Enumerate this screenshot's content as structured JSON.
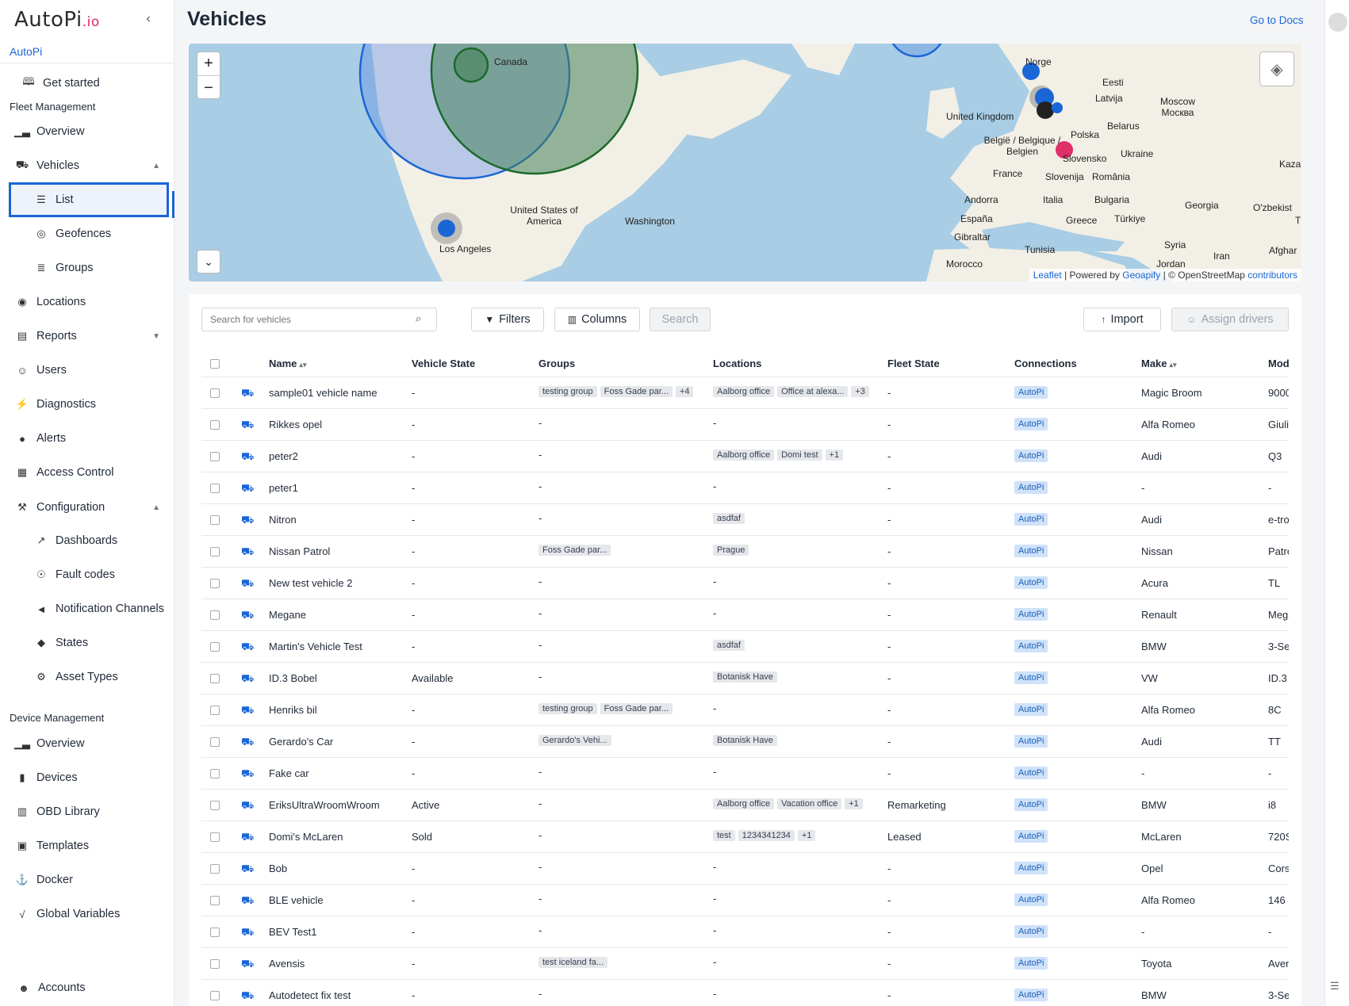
{
  "sidebar": {
    "logo_main": "AutoPi",
    "logo_suffix": ".io",
    "org": "AutoPi",
    "get_started": "Get started",
    "fleet_management": "Fleet Management",
    "overview": "Overview",
    "vehicles": "Vehicles",
    "list": "List",
    "geofences": "Geofences",
    "groups": "Groups",
    "locations": "Locations",
    "reports": "Reports",
    "users": "Users",
    "diagnostics": "Diagnostics",
    "alerts": "Alerts",
    "access_control": "Access Control",
    "configuration": "Configuration",
    "dashboards": "Dashboards",
    "fault_codes": "Fault codes",
    "notification_channels": "Notification Channels",
    "states": "States",
    "asset_types": "Asset Types",
    "device_management": "Device Management",
    "dm_overview": "Overview",
    "devices": "Devices",
    "obd_library": "OBD Library",
    "templates": "Templates",
    "docker": "Docker",
    "global_variables": "Global Variables",
    "accounts": "Accounts"
  },
  "header": {
    "title": "Vehicles",
    "docs_link": "Go to Docs"
  },
  "map": {
    "labels": [
      "Canada",
      "United States of America",
      "Washington",
      "Los Angeles",
      "Norge",
      "Eesti",
      "Latvija",
      "United Kingdom",
      "Moscow Москва",
      "Belarus",
      "België / Belgique / Belgien",
      "Polska",
      "Slovensko",
      "Ukraine",
      "France",
      "Slovenija",
      "România",
      "Kazak",
      "Andorra",
      "Italia",
      "Bulgaria",
      "Georgia",
      "O'zbekist",
      "España",
      "Greece",
      "Türkiye",
      "Gibraltar",
      "Tunisia",
      "Syria",
      "Afghar",
      "Morocco",
      "Iran",
      "Jordan",
      "T"
    ],
    "attribution_leaflet": "Leaflet",
    "attribution_powered": "| Powered by",
    "attribution_geoapify": "Geoapify",
    "attribution_osm": "| © OpenStreetMap",
    "attribution_contrib": "contributors"
  },
  "toolbar": {
    "search_placeholder": "Search for vehicles",
    "filters": "Filters",
    "columns": "Columns",
    "search": "Search",
    "import": "Import",
    "assign_drivers": "Assign drivers"
  },
  "table": {
    "headers": {
      "name": "Name",
      "vehicle_state": "Vehicle State",
      "groups": "Groups",
      "locations": "Locations",
      "fleet_state": "Fleet State",
      "connections": "Connections",
      "make": "Make",
      "model": "Mod"
    },
    "rows": [
      {
        "name": "sample01 vehicle name",
        "state": "-",
        "groups": [
          "testing group",
          "Foss Gade par...",
          "+4"
        ],
        "locations": [
          "Aalborg office",
          "Office at alexa...",
          "+3"
        ],
        "fleet": "-",
        "conn": "AutoPi",
        "make": "Magic Broom",
        "model": "9000"
      },
      {
        "name": "Rikkes opel",
        "state": "-",
        "groups": [],
        "locations": [],
        "fleet": "-",
        "conn": "AutoPi",
        "make": "Alfa Romeo",
        "model": "Giuli"
      },
      {
        "name": "peter2",
        "state": "-",
        "groups": [],
        "locations": [
          "Aalborg office",
          "Domi test",
          "+1"
        ],
        "fleet": "-",
        "conn": "AutoPi",
        "make": "Audi",
        "model": "Q3"
      },
      {
        "name": "peter1",
        "state": "-",
        "groups": [],
        "locations": [],
        "fleet": "-",
        "conn": "AutoPi",
        "make": "-",
        "model": "-"
      },
      {
        "name": "Nitron",
        "state": "-",
        "groups": [],
        "locations": [
          "asdfaf"
        ],
        "fleet": "-",
        "conn": "AutoPi",
        "make": "Audi",
        "model": "e-tro"
      },
      {
        "name": "Nissan Patrol",
        "state": "-",
        "groups": [
          "Foss Gade par..."
        ],
        "locations": [
          "Prague"
        ],
        "fleet": "-",
        "conn": "AutoPi",
        "make": "Nissan",
        "model": "Patro"
      },
      {
        "name": "New test vehicle 2",
        "state": "-",
        "groups": [],
        "locations": [],
        "fleet": "-",
        "conn": "AutoPi",
        "make": "Acura",
        "model": "TL"
      },
      {
        "name": "Megane",
        "state": "-",
        "groups": [],
        "locations": [],
        "fleet": "-",
        "conn": "AutoPi",
        "make": "Renault",
        "model": "Mega"
      },
      {
        "name": "Martin's Vehicle Test",
        "state": "-",
        "groups": [],
        "locations": [
          "asdfaf"
        ],
        "fleet": "-",
        "conn": "AutoPi",
        "make": "BMW",
        "model": "3-Se"
      },
      {
        "name": "ID.3 Bobel",
        "state": "Available",
        "groups": [],
        "locations": [
          "Botanisk Have"
        ],
        "fleet": "-",
        "conn": "AutoPi",
        "make": "VW",
        "model": "ID.3"
      },
      {
        "name": "Henriks bil",
        "state": "-",
        "groups": [
          "testing group",
          "Foss Gade par..."
        ],
        "locations": [],
        "fleet": "-",
        "conn": "AutoPi",
        "make": "Alfa Romeo",
        "model": "8C"
      },
      {
        "name": "Gerardo's Car",
        "state": "-",
        "groups": [
          "Gerardo's Vehi..."
        ],
        "locations": [
          "Botanisk Have"
        ],
        "fleet": "-",
        "conn": "AutoPi",
        "make": "Audi",
        "model": "TT"
      },
      {
        "name": "Fake car",
        "state": "-",
        "groups": [],
        "locations": [],
        "fleet": "-",
        "conn": "AutoPi",
        "make": "-",
        "model": "-"
      },
      {
        "name": "EriksUltraWroomWroom",
        "state": "Active",
        "groups": [],
        "locations": [
          "Aalborg office",
          "Vacation office",
          "+1"
        ],
        "fleet": "Remarketing",
        "conn": "AutoPi",
        "make": "BMW",
        "model": "i8"
      },
      {
        "name": "Domi's McLaren",
        "state": "Sold",
        "groups": [],
        "locations": [
          "test",
          "1234341234",
          "+1"
        ],
        "fleet": "Leased",
        "conn": "AutoPi",
        "make": "McLaren",
        "model": "720S"
      },
      {
        "name": "Bob",
        "state": "-",
        "groups": [],
        "locations": [],
        "fleet": "-",
        "conn": "AutoPi",
        "make": "Opel",
        "model": "Cors"
      },
      {
        "name": "BLE vehicle",
        "state": "-",
        "groups": [],
        "locations": [],
        "fleet": "-",
        "conn": "AutoPi",
        "make": "Alfa Romeo",
        "model": "146"
      },
      {
        "name": "BEV Test1",
        "state": "-",
        "groups": [],
        "locations": [],
        "fleet": "-",
        "conn": "AutoPi",
        "make": "-",
        "model": "-"
      },
      {
        "name": "Avensis",
        "state": "-",
        "groups": [
          "test iceland fa..."
        ],
        "locations": [],
        "fleet": "-",
        "conn": "AutoPi",
        "make": "Toyota",
        "model": "Aven"
      },
      {
        "name": "Autodetect fix test",
        "state": "-",
        "groups": [],
        "locations": [],
        "fleet": "-",
        "conn": "AutoPi",
        "make": "BMW",
        "model": "3-Se"
      }
    ]
  }
}
